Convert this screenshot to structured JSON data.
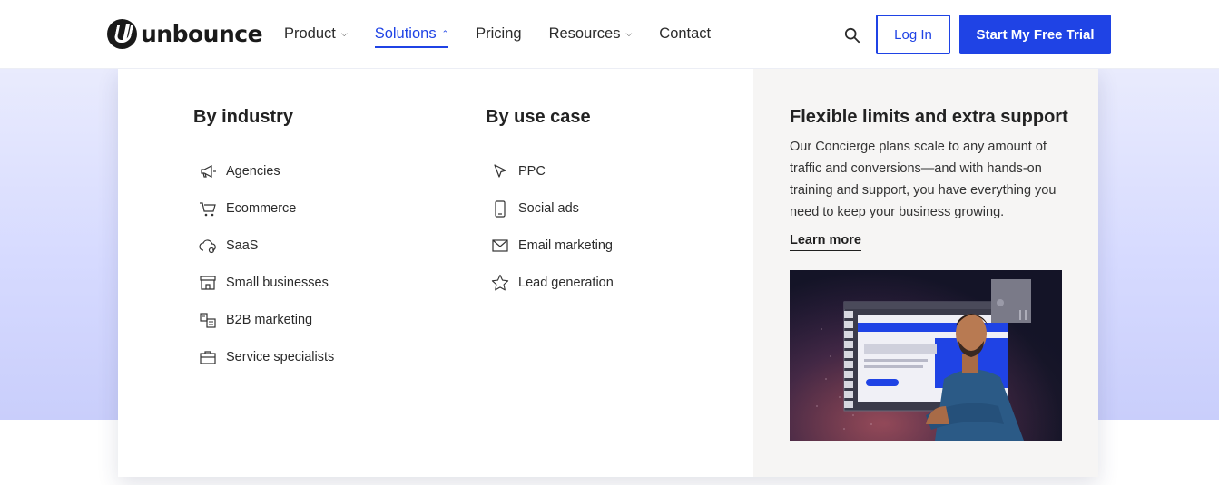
{
  "brand": {
    "name": "unbounce"
  },
  "nav": {
    "items": [
      {
        "label": "Product",
        "has_dropdown": true,
        "active": false
      },
      {
        "label": "Solutions",
        "has_dropdown": true,
        "active": true
      },
      {
        "label": "Pricing",
        "has_dropdown": false,
        "active": false
      },
      {
        "label": "Resources",
        "has_dropdown": true,
        "active": false
      },
      {
        "label": "Contact",
        "has_dropdown": false,
        "active": false
      }
    ],
    "search_icon": "search-icon",
    "login_label": "Log In",
    "trial_label": "Start My Free Trial"
  },
  "colors": {
    "accent": "#1f43e5",
    "hero_bg": "#d6daff",
    "side_panel": "#f6f5f4",
    "text": "#1f1f1f"
  },
  "mega_menu": {
    "by_industry": {
      "heading": "By industry",
      "items": [
        {
          "label": "Agencies",
          "icon": "megaphone-icon"
        },
        {
          "label": "Ecommerce",
          "icon": "cart-icon"
        },
        {
          "label": "SaaS",
          "icon": "cloud-gear-icon"
        },
        {
          "label": "Small businesses",
          "icon": "storefront-icon"
        },
        {
          "label": "B2B marketing",
          "icon": "buildings-icon"
        },
        {
          "label": "Service specialists",
          "icon": "briefcase-icon"
        }
      ]
    },
    "by_use_case": {
      "heading": "By use case",
      "items": [
        {
          "label": "PPC",
          "icon": "cursor-icon"
        },
        {
          "label": "Social ads",
          "icon": "phone-icon"
        },
        {
          "label": "Email marketing",
          "icon": "envelope-icon"
        },
        {
          "label": "Lead generation",
          "icon": "star-icon"
        }
      ]
    },
    "side": {
      "title": "Flexible limits and extra support",
      "body": "Our Concierge plans scale to any amount of traffic and conversions—and with hands-on training and support, you have everything you need to keep your business growing.",
      "link_label": "Learn more",
      "image_alt": "Man with crossed arms beside a landing page builder mockup"
    }
  }
}
